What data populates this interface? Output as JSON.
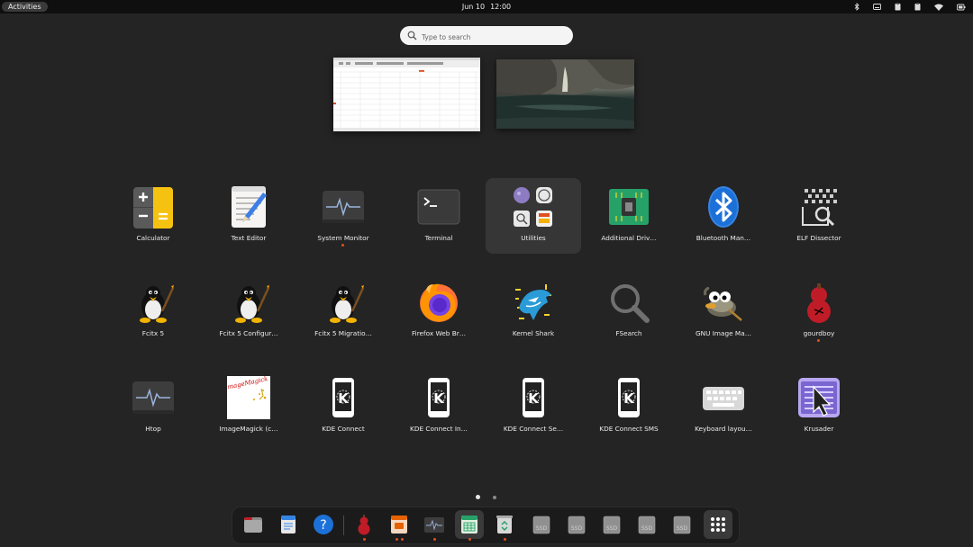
{
  "topbar": {
    "activities_label": "Activities",
    "date": "Jun 10",
    "time": "12:00",
    "tray_icons": [
      "bluetooth-icon",
      "keyboard-icon",
      "clipboard-icon",
      "clipboard-icon",
      "battery-icon",
      "wifi-icon",
      "power-icon"
    ]
  },
  "search": {
    "placeholder": "Type to search"
  },
  "workspaces": [
    {
      "name": "spreadsheet-window"
    },
    {
      "name": "waterfall-wallpaper"
    }
  ],
  "apps": [
    {
      "label": "Calculator",
      "icon": "calculator-icon"
    },
    {
      "label": "Text Editor",
      "icon": "text-editor-icon"
    },
    {
      "label": "System Monitor",
      "icon": "system-monitor-icon",
      "running": true
    },
    {
      "label": "Terminal",
      "icon": "terminal-icon"
    },
    {
      "label": "Utilities",
      "icon": "folder-icon",
      "folder": true
    },
    {
      "label": "Additional Driv…",
      "icon": "chip-icon"
    },
    {
      "label": "Bluetooth Man…",
      "icon": "bluetooth-icon"
    },
    {
      "label": "ELF Dissector",
      "icon": "elf-dissector-icon"
    },
    {
      "label": "Fcitx 5",
      "icon": "penguin-icon"
    },
    {
      "label": "Fcitx 5 Configur…",
      "icon": "penguin-icon"
    },
    {
      "label": "Fcitx 5 Migratio…",
      "icon": "penguin-icon"
    },
    {
      "label": "Firefox Web Br…",
      "icon": "firefox-icon"
    },
    {
      "label": "Kernel Shark",
      "icon": "shark-icon"
    },
    {
      "label": "FSearch",
      "icon": "magnifier-icon"
    },
    {
      "label": "GNU Image Ma…",
      "icon": "gimp-icon"
    },
    {
      "label": "gourdboy",
      "icon": "gourd-icon",
      "running": true
    },
    {
      "label": "Htop",
      "icon": "htop-icon"
    },
    {
      "label": "ImageMagick (c…",
      "icon": "imagemagick-icon"
    },
    {
      "label": "KDE Connect",
      "icon": "kde-connect-icon"
    },
    {
      "label": "KDE Connect In…",
      "icon": "kde-connect-icon"
    },
    {
      "label": "KDE Connect Se…",
      "icon": "kde-connect-icon"
    },
    {
      "label": "KDE Connect SMS",
      "icon": "kde-connect-icon"
    },
    {
      "label": "Keyboard layou…",
      "icon": "keyboard-icon"
    },
    {
      "label": "Krusader",
      "icon": "krusader-icon"
    }
  ],
  "pages": {
    "count": 2,
    "current": 1
  },
  "dock": {
    "items": [
      {
        "icon": "files-icon"
      },
      {
        "icon": "document-viewer-icon"
      },
      {
        "icon": "help-icon"
      },
      {
        "icon": "gourd-icon",
        "running": true
      },
      {
        "icon": "presentation-icon",
        "running": true,
        "windows": 2
      },
      {
        "icon": "system-monitor-icon",
        "running": true
      },
      {
        "icon": "spreadsheet-icon",
        "running": true,
        "active": true
      },
      {
        "icon": "trash-icon",
        "running": true
      },
      {
        "icon": "drive-icon",
        "label": "SSD"
      },
      {
        "icon": "drive-icon",
        "label": "SSD"
      },
      {
        "icon": "drive-icon",
        "label": "SSD"
      },
      {
        "icon": "drive-icon",
        "label": "SSD"
      },
      {
        "icon": "drive-icon",
        "label": "SSD"
      },
      {
        "icon": "app-grid-icon",
        "active": true
      }
    ]
  }
}
